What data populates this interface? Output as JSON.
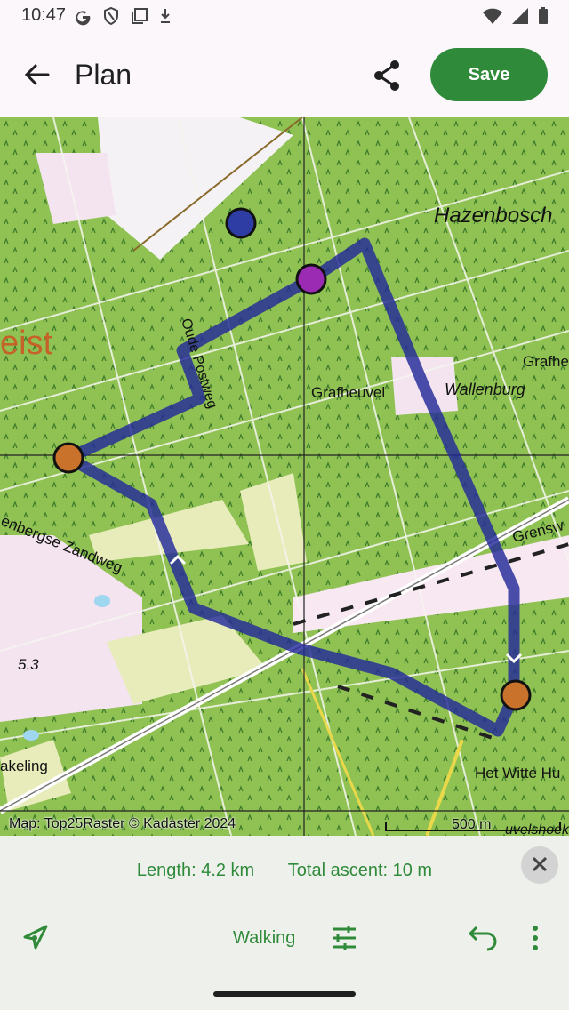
{
  "status_bar": {
    "time": "10:47"
  },
  "app_bar": {
    "title": "Plan",
    "save_label": "Save"
  },
  "map": {
    "labels": {
      "hazenbosch": "Hazenbosch",
      "grafheuvel": "Grafheuvel",
      "wallenburg": "Wallenburg",
      "grafh": "Grafhe",
      "oude_postweg": "Oude Postweg",
      "zandweg": "enbergse Zandweg",
      "grensw": "Grensw",
      "zeist": "eist",
      "spot_height": "5.3",
      "keling": "akeling",
      "witte_huis": "Het Witte Hu",
      "uvelshoek": "uvelshoek"
    },
    "attribution": "Map: Top25Raster © Kadaster 2024",
    "scale_label": "500 m",
    "colors": {
      "route": "#232a9a",
      "waypoint_orange": "#c8722c",
      "waypoint_purple": "#9b2bb3",
      "waypoint_blue": "#2d3da3"
    }
  },
  "bottom_panel": {
    "length": "Length: 4.2 km",
    "ascent": "Total ascent: 10 m",
    "mode": "Walking"
  },
  "colors": {
    "accent": "#2f8a3a"
  }
}
